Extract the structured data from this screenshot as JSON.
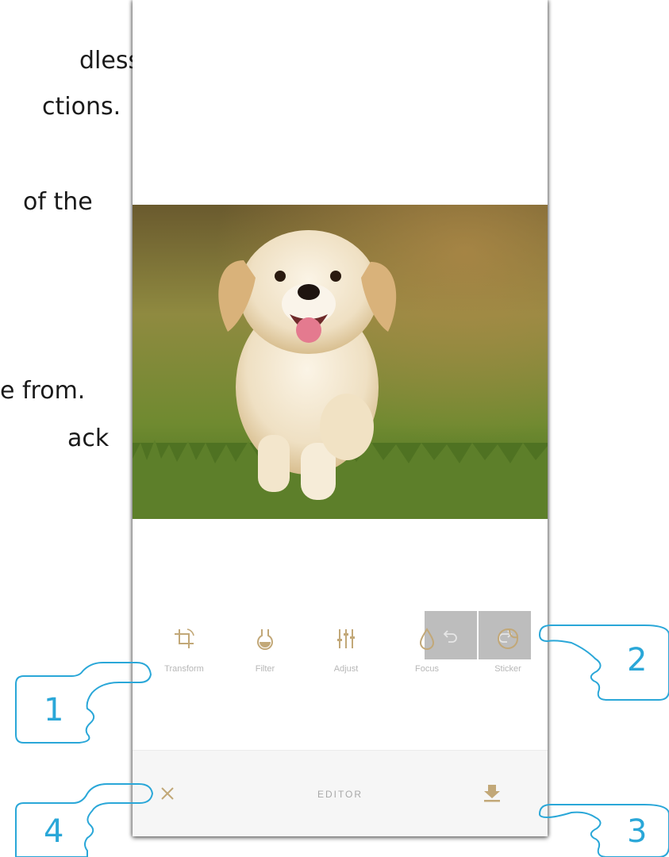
{
  "background_text": {
    "line1": "dless",
    "line2": "ctions.",
    "line3": "of the",
    "line4": "e from.",
    "line5": "ack"
  },
  "editor": {
    "title": "EDITOR",
    "undo_icon": "undo-icon",
    "redo_icon": "redo-icon",
    "close_icon": "close-icon",
    "save_icon": "download-icon",
    "tools": [
      {
        "label": "Transform",
        "icon": "crop-rotate-icon"
      },
      {
        "label": "Filter",
        "icon": "filter-flask-icon"
      },
      {
        "label": "Adjust",
        "icon": "sliders-icon"
      },
      {
        "label": "Focus",
        "icon": "drop-icon"
      },
      {
        "label": "Sticker",
        "icon": "sticker-icon"
      }
    ]
  },
  "callouts": {
    "n1": "1",
    "n2": "2",
    "n3": "3",
    "n4": "4",
    "color": "#2aa7d8"
  },
  "colors": {
    "icon_gold": "#c2a878",
    "button_gray": "#bdbdbd"
  }
}
